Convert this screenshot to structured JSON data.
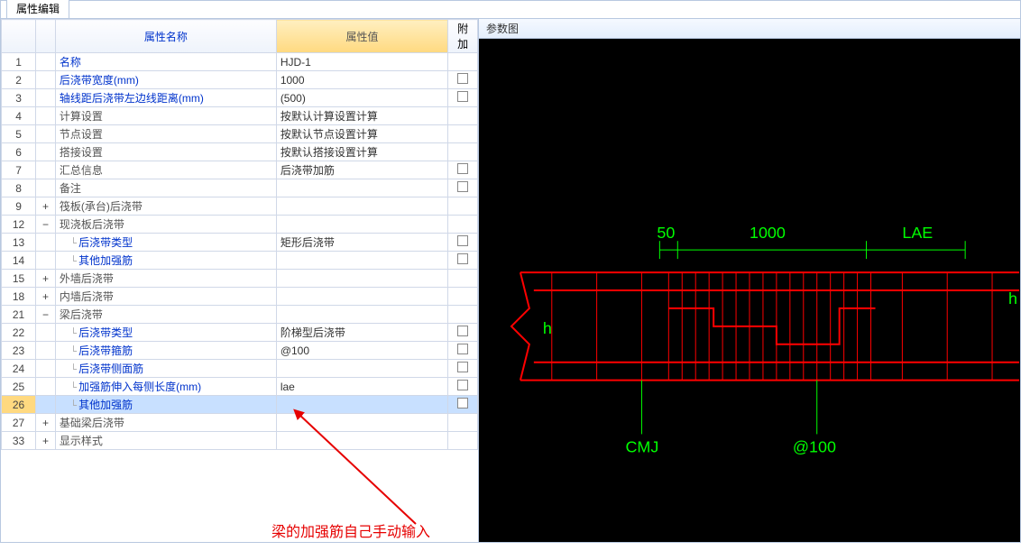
{
  "tab_title": "属性编辑",
  "columns": {
    "name": "属性名称",
    "value": "属性值",
    "attach": "附加"
  },
  "rows": [
    {
      "num": "1",
      "exp": "",
      "name": "名称",
      "val": "HJD-1",
      "att": false,
      "link": true
    },
    {
      "num": "2",
      "exp": "",
      "name": "后浇带宽度(mm)",
      "val": "1000",
      "att": true,
      "link": true
    },
    {
      "num": "3",
      "exp": "",
      "name": "轴线距后浇带左边线距离(mm)",
      "val": "(500)",
      "att": true,
      "link": true
    },
    {
      "num": "4",
      "exp": "",
      "name": "计算设置",
      "val": "按默认计算设置计算",
      "att": false,
      "link": false
    },
    {
      "num": "5",
      "exp": "",
      "name": "节点设置",
      "val": "按默认节点设置计算",
      "att": false,
      "link": false
    },
    {
      "num": "6",
      "exp": "",
      "name": "搭接设置",
      "val": "按默认搭接设置计算",
      "att": false,
      "link": false
    },
    {
      "num": "7",
      "exp": "",
      "name": "汇总信息",
      "val": "后浇带加筋",
      "att": true,
      "link": false
    },
    {
      "num": "8",
      "exp": "",
      "name": "备注",
      "val": "",
      "att": true,
      "link": false
    },
    {
      "num": "9",
      "exp": "+",
      "name": "筏板(承台)后浇带",
      "val": "",
      "att": false,
      "group": true
    },
    {
      "num": "12",
      "exp": "−",
      "name": "现浇板后浇带",
      "val": "",
      "att": false,
      "group": true
    },
    {
      "num": "13",
      "exp": "",
      "name": "后浇带类型",
      "val": "矩形后浇带",
      "att": true,
      "child": true,
      "link": true
    },
    {
      "num": "14",
      "exp": "",
      "name": "其他加强筋",
      "val": "",
      "att": true,
      "child": true,
      "link": true
    },
    {
      "num": "15",
      "exp": "+",
      "name": "外墙后浇带",
      "val": "",
      "att": false,
      "group": true
    },
    {
      "num": "18",
      "exp": "+",
      "name": "内墙后浇带",
      "val": "",
      "att": false,
      "group": true
    },
    {
      "num": "21",
      "exp": "−",
      "name": "梁后浇带",
      "val": "",
      "att": false,
      "group": true
    },
    {
      "num": "22",
      "exp": "",
      "name": "后浇带类型",
      "val": "阶梯型后浇带",
      "att": true,
      "child": true,
      "link": true
    },
    {
      "num": "23",
      "exp": "",
      "name": "后浇带箍筋",
      "val": "@100",
      "att": true,
      "child": true,
      "link": true
    },
    {
      "num": "24",
      "exp": "",
      "name": "后浇带侧面筋",
      "val": "",
      "att": true,
      "child": true,
      "link": true
    },
    {
      "num": "25",
      "exp": "",
      "name": "加强筋伸入每侧长度(mm)",
      "val": "lae",
      "att": true,
      "child": true,
      "link": true
    },
    {
      "num": "26",
      "exp": "",
      "name": "其他加强筋",
      "val": "",
      "att": true,
      "child": true,
      "link": true,
      "selected": true
    },
    {
      "num": "27",
      "exp": "+",
      "name": "基础梁后浇带",
      "val": "",
      "att": false,
      "group": true
    },
    {
      "num": "33",
      "exp": "+",
      "name": "显示样式",
      "val": "",
      "att": false,
      "group": true
    }
  ],
  "right_title": "参数图",
  "drawing_labels": {
    "dim50": "50",
    "dim1000": "1000",
    "lae": "LAE",
    "h_left": "h",
    "h_right": "h",
    "cmj": "CMJ",
    "spacing": "@100"
  },
  "annotation_text": "梁的加强筋自己手动输入"
}
